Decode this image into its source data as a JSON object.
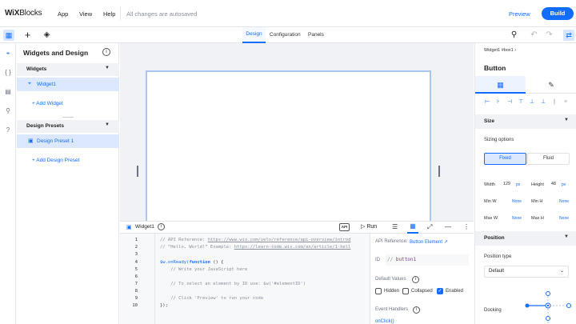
{
  "app": {
    "logo_bold": "WiX",
    "logo_light": "Blocks",
    "menu": [
      "App",
      "View",
      "Help"
    ],
    "autosave": "All changes are autosaved",
    "preview": "Preview",
    "build": "Build",
    "accent": "#116dff"
  },
  "center_tabs": [
    "Design",
    "Configuration",
    "Panels"
  ],
  "left_panel": {
    "title": "Widgets and Design",
    "widgets_header": "Widgets",
    "widget_item": "Widget1",
    "add_widget": "+ Add Widget",
    "presets_header": "Design Presets",
    "preset_item": "Design Preset 1",
    "add_preset": "+ Add Design Preset"
  },
  "editor": {
    "tab": "Widget1",
    "run": "Run",
    "line_numbers": [
      "1",
      "2",
      "3",
      "4",
      "5",
      "6",
      "7",
      "8",
      "9",
      "10"
    ],
    "code": {
      "l1_pre": "// API Reference: ",
      "l1_url": "https://www.wix.com/velo/reference/api-overview/introd",
      "l2_pre": "// “Hello, World!” Example: ",
      "l2_url": "https://learn-code.wix.com/en/article/1-hell",
      "l4_a": "$w.onReady(",
      "l4_kw": "function",
      "l4_b": " () {",
      "l5": "    // Write your JavaScript here",
      "l7": "    // To select an element by ID use: $w('#elementID')",
      "l9": "    // Click 'Preview' to run your code",
      "l10": "});"
    }
  },
  "props": {
    "api_ref_label": "API Reference:",
    "api_ref_link": "Button Element",
    "id_label": "ID",
    "id_prefix": "//",
    "id_value": "button1",
    "default_values": "Default Values",
    "hidden": "Hidden",
    "collapsed": "Collapsed",
    "enabled": "Enabled",
    "event_handlers": "Event Handlers",
    "onclick": "onClick()"
  },
  "right_panel": {
    "breadcrumb": "Widget1 #box1",
    "title": "Button",
    "size_header": "Size",
    "sizing_options": "Sizing options",
    "fixed": "Fixed",
    "fluid": "Fluid",
    "width_label": "Width",
    "width_value": "129",
    "height_label": "Height",
    "height_value": "48",
    "unit": "px",
    "min_w": "Min W",
    "min_h": "Min H",
    "max_w": "Max W",
    "max_h": "Max H",
    "none": "None",
    "position_header": "Position",
    "position_type": "Position type",
    "position_value": "Default",
    "docking": "Docking"
  }
}
